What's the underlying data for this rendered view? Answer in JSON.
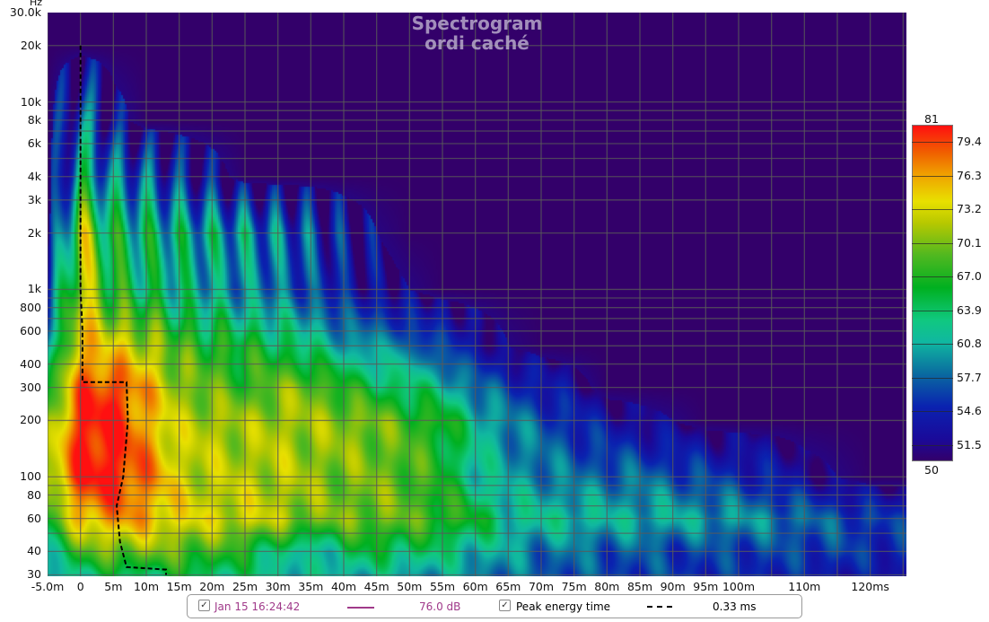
{
  "chart_data": {
    "type": "heatmap",
    "title": "Spectrogram",
    "subtitle": "ordi caché",
    "ylabel": "Hz",
    "xlabel": "ms",
    "xlim": [
      -5,
      125.5
    ],
    "ylim": [
      29.5,
      30000
    ],
    "yscale": "log",
    "grid": true,
    "x_ticks": [
      {
        "v": -5,
        "label": "-5.0m"
      },
      {
        "v": 0,
        "label": "0"
      },
      {
        "v": 5,
        "label": "5m"
      },
      {
        "v": 10,
        "label": "10m"
      },
      {
        "v": 15,
        "label": "15m"
      },
      {
        "v": 20,
        "label": "20m"
      },
      {
        "v": 25,
        "label": "25m"
      },
      {
        "v": 30,
        "label": "30m"
      },
      {
        "v": 35,
        "label": "35m"
      },
      {
        "v": 40,
        "label": "40m"
      },
      {
        "v": 45,
        "label": "45m"
      },
      {
        "v": 50,
        "label": "50m"
      },
      {
        "v": 55,
        "label": "55m"
      },
      {
        "v": 60,
        "label": "60m"
      },
      {
        "v": 65,
        "label": "65m"
      },
      {
        "v": 70,
        "label": "70m"
      },
      {
        "v": 75,
        "label": "75m"
      },
      {
        "v": 80,
        "label": "80m"
      },
      {
        "v": 85,
        "label": "85m"
      },
      {
        "v": 90,
        "label": "90m"
      },
      {
        "v": 95,
        "label": "95m"
      },
      {
        "v": 100,
        "label": "100m"
      },
      {
        "v": 110,
        "label": "110m"
      },
      {
        "v": 120,
        "label": "120ms"
      }
    ],
    "x_grid": [
      -5,
      0,
      5,
      10,
      15,
      20,
      25,
      30,
      35,
      40,
      45,
      50,
      55,
      60,
      65,
      70,
      75,
      80,
      85,
      90,
      95,
      100,
      105,
      110,
      115,
      120,
      125
    ],
    "y_ticks": [
      {
        "v": 30000,
        "label": "30.0k"
      },
      {
        "v": 20000,
        "label": "20k"
      },
      {
        "v": 10000,
        "label": "10k"
      },
      {
        "v": 8000,
        "label": "8k"
      },
      {
        "v": 6000,
        "label": "6k"
      },
      {
        "v": 4000,
        "label": "4k"
      },
      {
        "v": 3000,
        "label": "3k"
      },
      {
        "v": 2000,
        "label": "2k"
      },
      {
        "v": 1000,
        "label": "1k"
      },
      {
        "v": 800,
        "label": "800"
      },
      {
        "v": 600,
        "label": "600"
      },
      {
        "v": 400,
        "label": "400"
      },
      {
        "v": 300,
        "label": "300"
      },
      {
        "v": 200,
        "label": "200"
      },
      {
        "v": 100,
        "label": "100"
      },
      {
        "v": 80,
        "label": "80"
      },
      {
        "v": 60,
        "label": "60"
      },
      {
        "v": 40,
        "label": "40"
      },
      {
        "v": 30,
        "label": "30"
      }
    ],
    "y_grid": [
      20000,
      10000,
      9000,
      8000,
      7000,
      6000,
      5000,
      4000,
      3000,
      2000,
      1000,
      900,
      800,
      700,
      600,
      500,
      400,
      300,
      200,
      100,
      90,
      80,
      70,
      60,
      50,
      40,
      30
    ],
    "z_range": [
      50,
      81
    ],
    "colorbar": {
      "top_label": "81",
      "bottom_label": "50",
      "ticks": [
        79.4,
        76.3,
        73.2,
        70.1,
        67.0,
        63.9,
        60.8,
        57.7,
        54.6,
        51.5
      ],
      "tick_labels": [
        "79.4",
        "76.3",
        "73.2",
        "70.1",
        "67.0",
        "63.9",
        "60.8",
        "57.7",
        "54.6",
        "51.5"
      ],
      "color_stops": [
        [
          50,
          "#33006a"
        ],
        [
          52,
          "#1a0a9a"
        ],
        [
          55,
          "#0a22b0"
        ],
        [
          58,
          "#0a6aa0"
        ],
        [
          61,
          "#10b8a0"
        ],
        [
          63,
          "#10c880"
        ],
        [
          66,
          "#00b020"
        ],
        [
          69,
          "#50b820"
        ],
        [
          72,
          "#b8c800"
        ],
        [
          74,
          "#e8e000"
        ],
        [
          76.5,
          "#f0a000"
        ],
        [
          78.5,
          "#f06000"
        ],
        [
          81,
          "#ff1010"
        ]
      ]
    },
    "grid_times_ms": [
      -5,
      0,
      5,
      10,
      15,
      20,
      25,
      30,
      35,
      40,
      45,
      50,
      55,
      60,
      65,
      70,
      75,
      80,
      85,
      90,
      95,
      100,
      105,
      110,
      115,
      120,
      125
    ],
    "grid_freqs_hz": [
      30,
      40,
      60,
      100,
      200,
      300,
      500,
      1000,
      2000,
      4000,
      8000,
      20000
    ],
    "level_db": [
      [
        60,
        63,
        64,
        64,
        65,
        64,
        63,
        62,
        61,
        61,
        61,
        60,
        60,
        59,
        58,
        57,
        57,
        56,
        56,
        56,
        55,
        55,
        55,
        54,
        54,
        53,
        53
      ],
      [
        62,
        68,
        70,
        70,
        69,
        68,
        66,
        63,
        60,
        64,
        65,
        64,
        63,
        61,
        60,
        58,
        58,
        57,
        57,
        56,
        56,
        56,
        56,
        56,
        56,
        55,
        55
      ],
      [
        66,
        76,
        77,
        76,
        74,
        73,
        73,
        72,
        70,
        70,
        70,
        69,
        68,
        66,
        62,
        62,
        62,
        61,
        61,
        61,
        60,
        60,
        59,
        58,
        57,
        56,
        55
      ],
      [
        72,
        81,
        81,
        78,
        73,
        72,
        72,
        72,
        71,
        70,
        70,
        69,
        66,
        62,
        60,
        59,
        58,
        58,
        58,
        57,
        56,
        55,
        54,
        52,
        51,
        50,
        50
      ],
      [
        70,
        81,
        81,
        76,
        72,
        72,
        71,
        72,
        71,
        71,
        70,
        68,
        67,
        62,
        59,
        57,
        55,
        53,
        52,
        51,
        50,
        50,
        50,
        50,
        50,
        50,
        50
      ],
      [
        66,
        79,
        80,
        76,
        71,
        69,
        68,
        70,
        70,
        67,
        65,
        64,
        62,
        58,
        56,
        54,
        52,
        50,
        50,
        50,
        50,
        50,
        50,
        50,
        50,
        50,
        50
      ],
      [
        60,
        76,
        74,
        72,
        68,
        67,
        66,
        65,
        63,
        60,
        60,
        58,
        56,
        53,
        51,
        50,
        50,
        50,
        50,
        50,
        50,
        50,
        50,
        50,
        50,
        50,
        50
      ],
      [
        55,
        73,
        66,
        64,
        62,
        60,
        59,
        58,
        56,
        54,
        52,
        51,
        50,
        50,
        50,
        50,
        50,
        50,
        50,
        50,
        50,
        50,
        50,
        50,
        50,
        50,
        50
      ],
      [
        50,
        72,
        64,
        63,
        62,
        61,
        60,
        58,
        56,
        53,
        51,
        50,
        50,
        50,
        50,
        50,
        50,
        50,
        50,
        50,
        50,
        50,
        50,
        50,
        50,
        50,
        50
      ],
      [
        50,
        62,
        58,
        57,
        54,
        52,
        50,
        50,
        50,
        50,
        50,
        50,
        50,
        50,
        50,
        50,
        50,
        50,
        50,
        50,
        50,
        50,
        50,
        50,
        50,
        50,
        50
      ],
      [
        50,
        58,
        52,
        50,
        50,
        50,
        50,
        50,
        50,
        50,
        50,
        50,
        50,
        50,
        50,
        50,
        50,
        50,
        50,
        50,
        50,
        50,
        50,
        50,
        50,
        50,
        50
      ],
      [
        50,
        50,
        50,
        50,
        50,
        50,
        50,
        50,
        50,
        50,
        50,
        50,
        50,
        50,
        50,
        50,
        50,
        50,
        50,
        50,
        50,
        50,
        50,
        50,
        50,
        50,
        50
      ]
    ],
    "peak_energy_curve": [
      [
        0,
        20000
      ],
      [
        0,
        1000
      ],
      [
        0.3,
        600
      ],
      [
        0.3,
        320
      ],
      [
        7,
        320
      ],
      [
        7.2,
        200
      ],
      [
        6.5,
        100
      ],
      [
        5.5,
        70
      ],
      [
        6,
        45
      ],
      [
        7,
        33
      ],
      [
        13,
        32
      ],
      [
        13,
        30
      ]
    ]
  },
  "legend": {
    "entries": [
      {
        "label": "Jan 15 16:24:42",
        "value": "76.0 dB",
        "color": "#a03a8a",
        "style": "solid",
        "checked": true
      },
      {
        "label": "Peak energy time",
        "value": "0.33 ms",
        "color": "#000000",
        "style": "dashed",
        "checked": true
      }
    ],
    "check_glyph": "✓"
  }
}
